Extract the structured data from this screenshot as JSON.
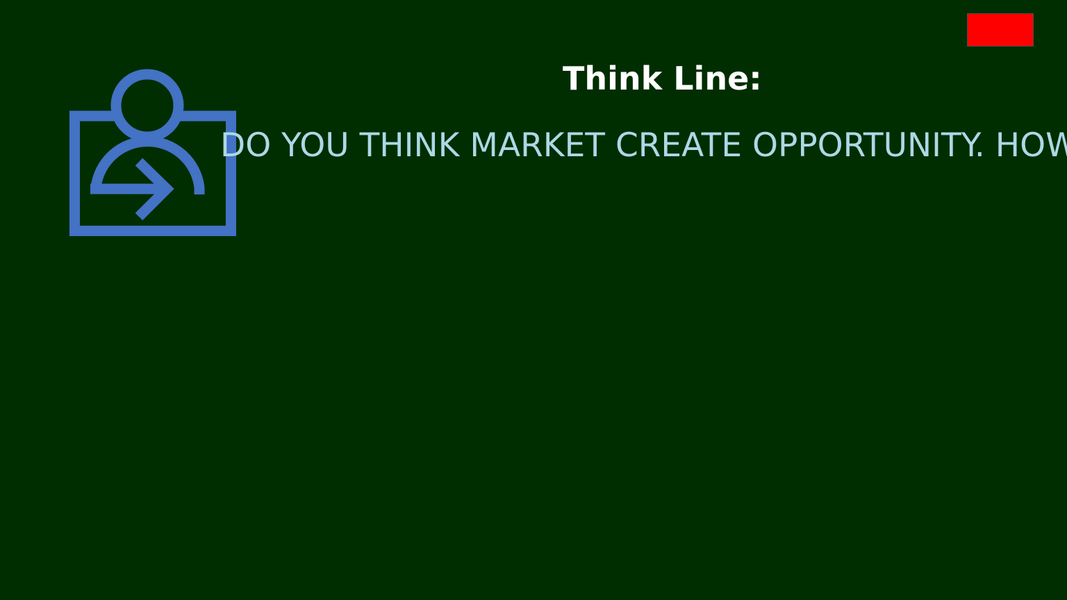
{
  "window": {
    "background_color": "#002e00"
  },
  "close_button": {
    "color": "#ff0000"
  },
  "icon": {
    "name": "user-login-icon",
    "color": "#4472c4"
  },
  "title": "Think Line:",
  "question": "DO YOU THINK MARKET CREATE OPPORTUNITY. HOW"
}
